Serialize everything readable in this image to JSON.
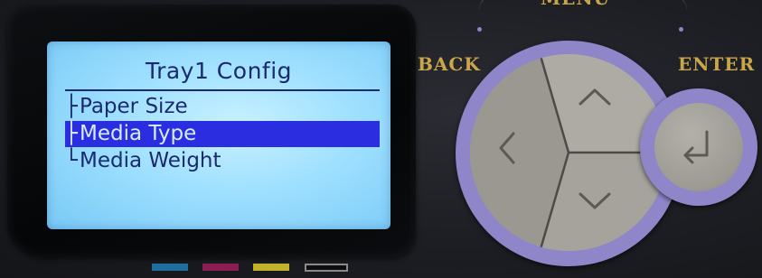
{
  "lcd": {
    "title": "Tray1 Config",
    "menu_items": [
      {
        "tree": "├",
        "label": "Paper Size",
        "selected": false
      },
      {
        "tree": "├",
        "label": "Media Type",
        "selected": true
      },
      {
        "tree": "└",
        "label": "Media Weight",
        "selected": false
      }
    ]
  },
  "controls": {
    "back_label": "BACK",
    "enter_label": "ENTER",
    "menu_label": "MENU"
  },
  "icons": {
    "up": "chevron-up-icon",
    "down": "chevron-down-icon",
    "left": "chevron-left-icon",
    "enter": "enter-return-icon"
  },
  "colors": {
    "lcd_background": "#a8e4ff",
    "lcd_text": "#1a2a6e",
    "selection": "#2b2ee0",
    "button_ring": "#8f86c9",
    "button_face": "#a3a09a",
    "label_gold": "#c9a64a",
    "toner_cyan": "#1e6f9e",
    "toner_magenta": "#8a1d52",
    "toner_yellow": "#c0b22a",
    "toner_black": "#0d0d0f"
  }
}
